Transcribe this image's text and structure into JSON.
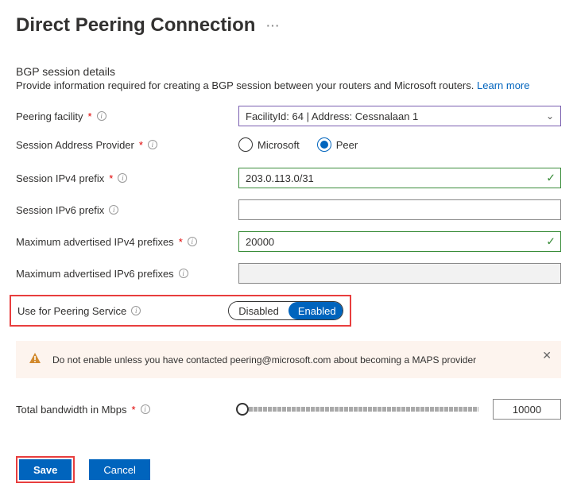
{
  "header": {
    "title": "Direct Peering Connection"
  },
  "section": {
    "title": "BGP session details",
    "desc": "Provide information required for creating a BGP session between your routers and Microsoft routers. ",
    "learn_more": "Learn more"
  },
  "labels": {
    "facility": "Peering facility",
    "session_provider": "Session Address Provider",
    "ipv4_prefix": "Session IPv4 prefix",
    "ipv6_prefix": "Session IPv6 prefix",
    "max_v4": "Maximum advertised IPv4 prefixes",
    "max_v6": "Maximum advertised IPv6 prefixes",
    "use_peering": "Use for Peering Service",
    "bandwidth": "Total bandwidth in Mbps"
  },
  "values": {
    "facility": "FacilityId: 64 | Address: Cessnalaan 1",
    "provider_opts": {
      "ms": "Microsoft",
      "peer": "Peer"
    },
    "ipv4_prefix": "203.0.113.0/31",
    "ipv6_prefix": "",
    "max_v4": "20000",
    "max_v6": "",
    "toggle": {
      "off": "Disabled",
      "on": "Enabled"
    },
    "bandwidth": "10000"
  },
  "warning": {
    "text": "Do not enable unless you have contacted peering@microsoft.com about becoming a MAPS provider"
  },
  "footer": {
    "save": "Save",
    "cancel": "Cancel"
  }
}
